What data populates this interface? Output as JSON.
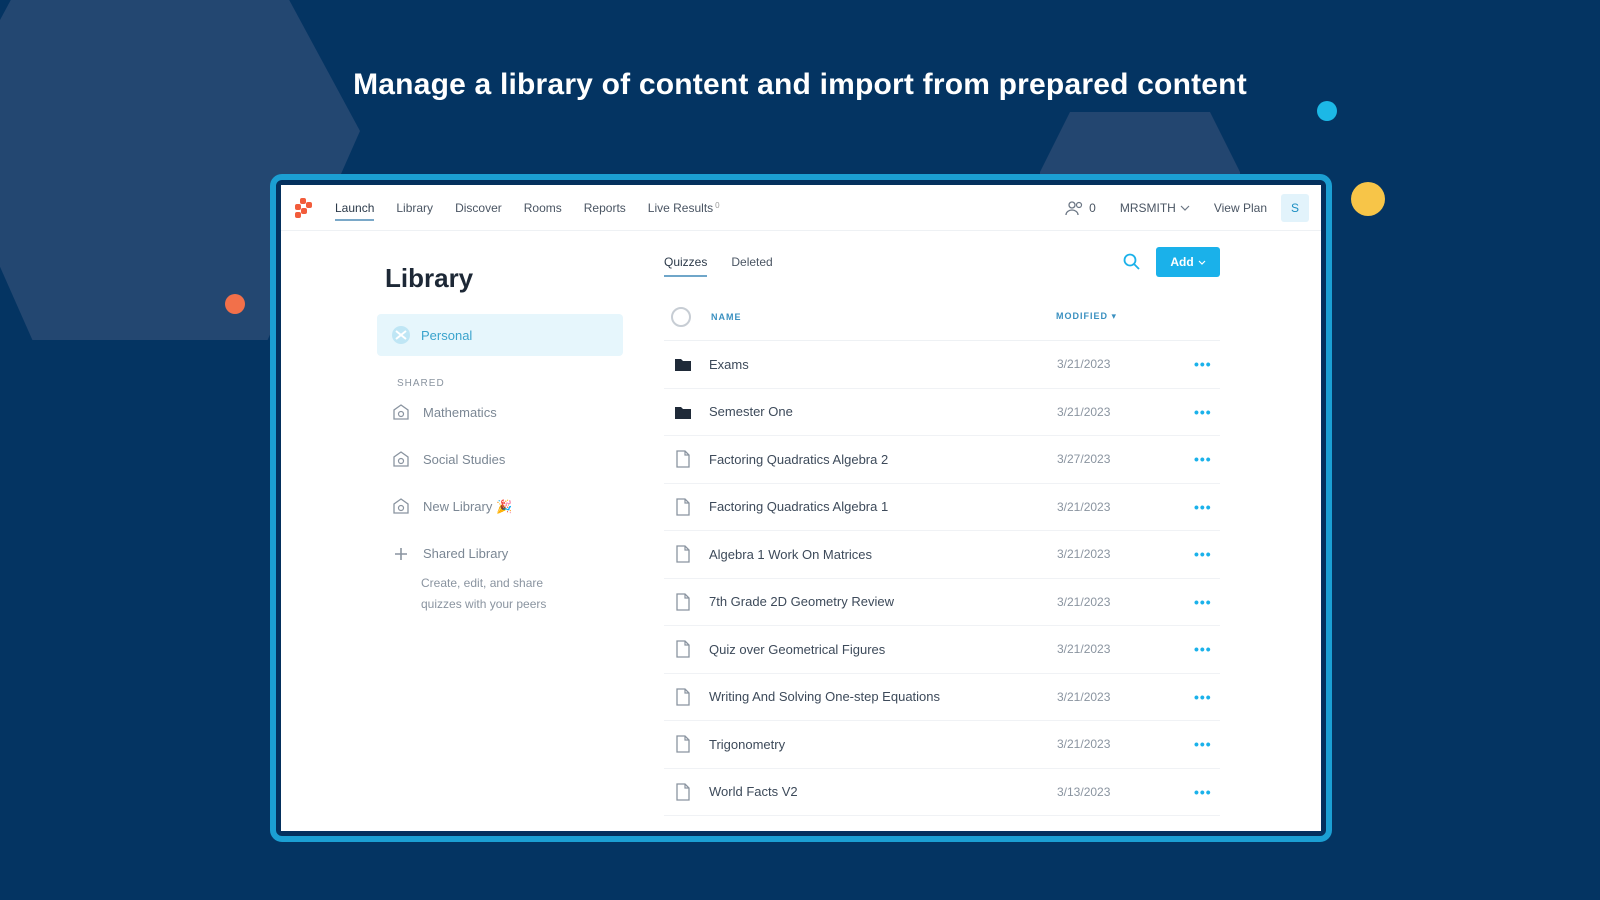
{
  "headline": "Manage a library of content and import from prepared content",
  "colors": {
    "background": "#043462",
    "accent": "#1ab1ea",
    "frame": "#1b9fd3",
    "logo": "#f25c3b"
  },
  "nav": {
    "items": [
      {
        "label": "Launch",
        "active": true
      },
      {
        "label": "Library"
      },
      {
        "label": "Discover"
      },
      {
        "label": "Rooms"
      },
      {
        "label": "Reports"
      },
      {
        "label": "Live Results",
        "sup": "0"
      }
    ],
    "users_count": "0",
    "username": "MRSMITH",
    "view_plan": "View Plan",
    "avatar_letter": "S"
  },
  "sidebar": {
    "title": "Library",
    "personal": "Personal",
    "shared_label": "SHARED",
    "items": [
      {
        "label": "Mathematics",
        "icon": "shared-library-icon"
      },
      {
        "label": "Social Studies",
        "icon": "shared-library-icon"
      },
      {
        "label": "New Library 🎉",
        "icon": "shared-library-icon"
      },
      {
        "label": "Shared Library",
        "icon": "plus-icon"
      }
    ],
    "shared_desc_line1": "Create, edit, and share",
    "shared_desc_line2": "quizzes with your peers"
  },
  "main": {
    "tabs": [
      {
        "label": "Quizzes",
        "active": true
      },
      {
        "label": "Deleted"
      }
    ],
    "add_label": "Add",
    "columns": {
      "name": "NAME",
      "modified": "MODIFIED"
    },
    "rows": [
      {
        "type": "folder",
        "name": "Exams",
        "date": "3/21/2023"
      },
      {
        "type": "folder",
        "name": "Semester One",
        "date": "3/21/2023"
      },
      {
        "type": "file",
        "name": "Factoring Quadratics Algebra 2",
        "date": "3/27/2023"
      },
      {
        "type": "file",
        "name": "Factoring Quadratics Algebra 1",
        "date": "3/21/2023"
      },
      {
        "type": "file",
        "name": "Algebra 1 Work On Matrices",
        "date": "3/21/2023"
      },
      {
        "type": "file",
        "name": "7th Grade 2D Geometry Review",
        "date": "3/21/2023"
      },
      {
        "type": "file",
        "name": "Quiz over Geometrical Figures",
        "date": "3/21/2023"
      },
      {
        "type": "file",
        "name": "Writing And Solving One-step Equations",
        "date": "3/21/2023"
      },
      {
        "type": "file",
        "name": "Trigonometry",
        "date": "3/21/2023"
      },
      {
        "type": "file",
        "name": "World Facts V2",
        "date": "3/13/2023"
      }
    ],
    "more_label": "•••"
  }
}
